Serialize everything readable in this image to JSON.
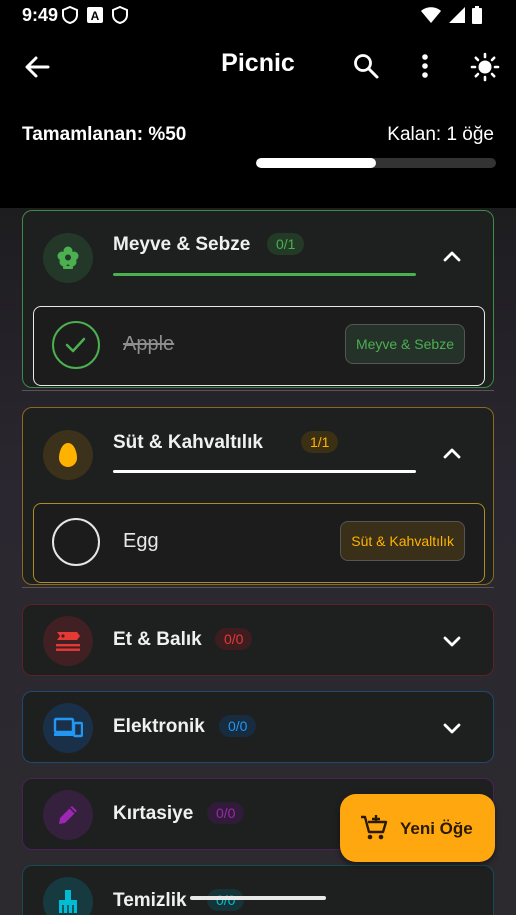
{
  "status_bar": {
    "time": "9:49"
  },
  "app_bar": {
    "title": "Picnic",
    "icons": [
      "back-arrow-icon",
      "search-icon",
      "more-vert-icon",
      "brightness-icon"
    ]
  },
  "progress": {
    "completed_label": "Tamamlanan: %50",
    "remaining_label": "Kalan: 1 öğe",
    "fraction": 0.5
  },
  "categories": [
    {
      "name": "Meyve & Sebze",
      "count": "0/1",
      "color": "#4caf50",
      "icon": "flower-icon",
      "expanded": true,
      "items": [
        {
          "name": "Apple",
          "tag": "Meyve & Sebze",
          "checked": true
        }
      ]
    },
    {
      "name": "Süt & Kahvaltılık",
      "count": "1/1",
      "color": "#ffb300",
      "icon": "egg-icon",
      "expanded": true,
      "items": [
        {
          "name": "Egg",
          "tag": "Süt & Kahvaltılık",
          "checked": false
        }
      ]
    },
    {
      "name": "Et & Balık",
      "count": "0/0",
      "color": "#e53935",
      "icon": "fish-icon",
      "expanded": false
    },
    {
      "name": "Elektronik",
      "count": "0/0",
      "color": "#2196f3",
      "icon": "devices-icon",
      "expanded": false
    },
    {
      "name": "Kırtasiye",
      "count": "0/0",
      "color": "#9c27b0",
      "icon": "pencil-icon",
      "expanded": false
    },
    {
      "name": "Temizlik",
      "count": "0/0",
      "color": "#00bcd4",
      "icon": "cleaning-brush-icon",
      "expanded": false
    }
  ],
  "fab": {
    "label": "Yeni Öğe",
    "icon": "add-cart-icon"
  }
}
